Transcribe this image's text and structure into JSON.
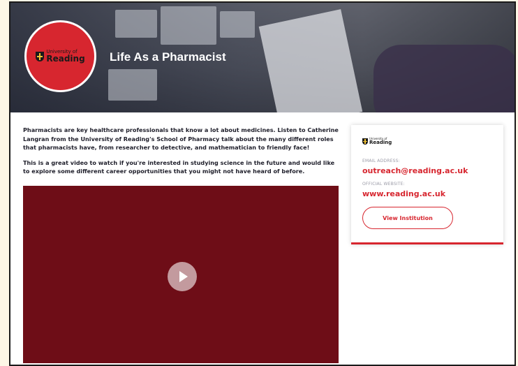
{
  "hero": {
    "title": "Life As a Pharmacist",
    "logo": {
      "top_text": "University of",
      "bottom_text": "Reading"
    }
  },
  "description": {
    "paragraph_1": "Pharmacists are key healthcare professionals that know a lot about medicines. Listen to Catherine Langran from the University of Reading's School of Pharmacy talk about the many different roles that pharmacists have, from researcher to detective, and mathematician to friendly face!",
    "paragraph_2": "This is a great video to watch if you're interested in studying science in the future and would like to explore some different career opportunities that you might not have heard of before."
  },
  "video": {
    "play_icon": "play-icon"
  },
  "card": {
    "logo": {
      "top_text": "University of",
      "bottom_text": "Reading"
    },
    "email_label": "EMAIL ADDRESS:",
    "email": "outreach@reading.ac.uk",
    "website_label": "OFFICIAL WEBSITE:",
    "website": "www.reading.ac.uk",
    "button_label": "View Institution"
  },
  "colors": {
    "brand_red": "#d7262f",
    "video_bg": "#6e0d17"
  }
}
